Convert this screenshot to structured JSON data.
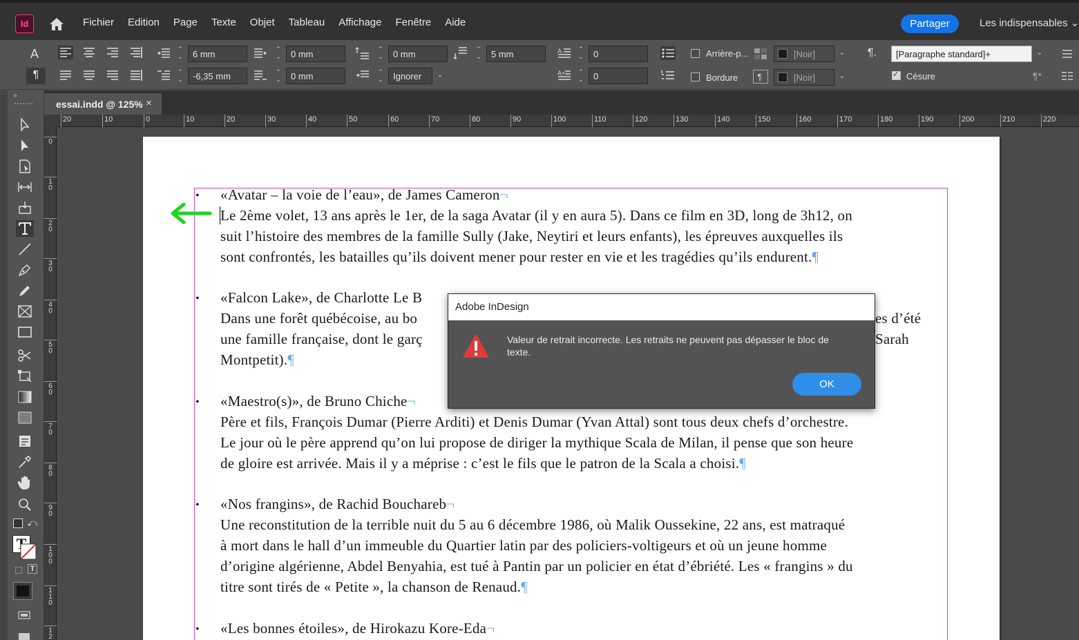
{
  "app": {
    "icon_label": "Id",
    "menu": [
      "Fichier",
      "Edition",
      "Page",
      "Texte",
      "Objet",
      "Tableau",
      "Affichage",
      "Fenêtre",
      "Aide"
    ],
    "share_label": "Partager",
    "workspace_label": "Les indispensables"
  },
  "control_panel": {
    "left_indent": "6 mm",
    "first_line_indent": "-6,35 mm",
    "right_indent": "0 mm",
    "last_line_indent": "0 mm",
    "space_before": "0 mm",
    "align_grid": "Ignorer",
    "space_after": "5 mm",
    "drop_cap_lines": "0",
    "drop_cap_chars": "0",
    "shading_label": "Arrière-p...",
    "border_label": "Bordure",
    "shading_color": "[Noir]",
    "border_color": "[Noir]",
    "paragraph_style": "[Paragraphe standard]+",
    "hyphenation_label": "Césure",
    "hyphenation_checked": true
  },
  "tab": {
    "label": "essai.indd @ 125%",
    "close": "×"
  },
  "ruler": {
    "h_labels": [
      "20",
      "10",
      "0",
      "10",
      "20",
      "30",
      "40",
      "50",
      "60",
      "70",
      "80",
      "90",
      "100",
      "110",
      "120",
      "130",
      "140",
      "150",
      "160",
      "170",
      "180",
      "190",
      "200",
      "210",
      "220"
    ],
    "v_labels": [
      "0",
      "10",
      "20",
      "30",
      "40",
      "50",
      "60",
      "70",
      "80",
      "90",
      "100",
      "110",
      "12"
    ]
  },
  "document": {
    "pilcrow": "¶",
    "bullet": "•",
    "lines": [
      "«Avatar – la voie de l’eau», de James Cameron",
      "Le 2ème volet, 13 ans après le 1er, de la saga Avatar (il y en aura 5). Dans ce film en 3D, long de 3h12, on",
      "suit l’histoire des membres de la famille Sully (Jake, Neytiri et leurs enfants), les épreuves auxquelles ils",
      "sont confrontés, les batailles qu’ils doivent mener pour rester en vie et les tragédies qu’ils endurent.",
      "«Falcon Lake», de Charlotte Le B",
      "Dans une forêt québécoise, au bo",
      "es d’été",
      "une famille française, dont le garç",
      "Sarah",
      "Montpetit).",
      "«Maestro(s)», de Bruno Chiche",
      "Père et fils, François Dumar (Pierre Arditi) et Denis Dumar (Yvan Attal) sont tous deux chefs d’orchestre.",
      "Le jour où le père apprend qu’on lui propose de diriger la mythique Scala de Milan, il pense que son heure",
      "de gloire est arrivée. Mais il y a méprise : c’est le fils que le patron de la Scala a choisi.",
      "«Nos frangins», de Rachid Bouchareb",
      "Une reconstitution de la terrible nuit du 5 au 6 décembre 1986, où Malik Oussekine, 22 ans, est matraqué",
      "à mort dans le hall d’un immeuble du Quartier latin par des policiers-voltigeurs et où un jeune homme",
      "d’origine algérienne, Abdel Benyahia, est tué à Pantin par un policier en état d’ébriété. Les « frangins » du",
      "titre sont tirés de « Petite », la chanson de Renaud.",
      "«Les bonnes étoiles», de Hirokazu Kore-Eda"
    ]
  },
  "dialog": {
    "title": "Adobe InDesign",
    "message": "Valeur de retrait incorrecte. Les retraits ne peuvent pas dépasser le bloc de texte.",
    "ok_label": "OK"
  },
  "colors": {
    "accent": "#1473e6",
    "frame": "#d53fd5",
    "arrow": "#1fd41f",
    "warning": "#e03a3a"
  }
}
